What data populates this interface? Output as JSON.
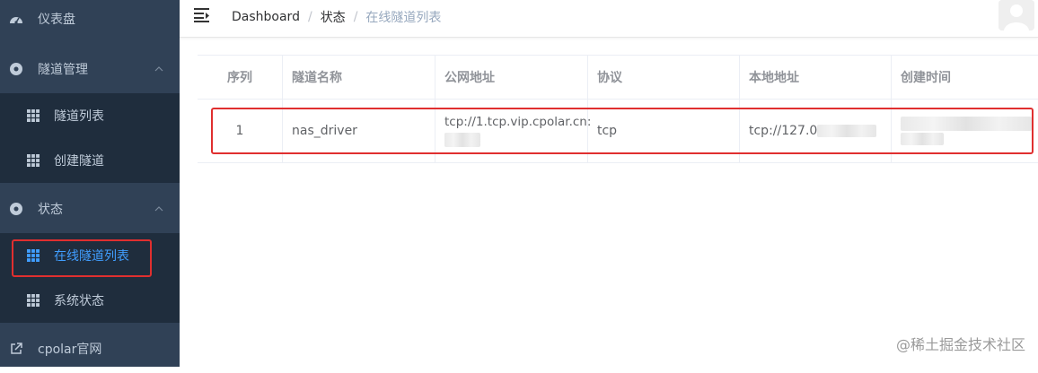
{
  "sidebar": {
    "dashboard": "仪表盘",
    "tunnel_mgmt": "隧道管理",
    "tunnel_list": "隧道列表",
    "create_tunnel": "创建隧道",
    "status": "状态",
    "online_tunnel_list": "在线隧道列表",
    "system_status": "系统状态",
    "cpolar_site": "cpolar官网"
  },
  "breadcrumb": {
    "home": "Dashboard",
    "mid": "状态",
    "current": "在线隧道列表",
    "sep": "/"
  },
  "table": {
    "headers": [
      "序列",
      "隧道名称",
      "公网地址",
      "协议",
      "本地地址",
      "创建时间"
    ],
    "row": {
      "index": "1",
      "name": "nas_driver",
      "public_addr": "tcp://1.tcp.vip.cpolar.cn:",
      "protocol": "tcp",
      "local_addr": "tcp://127.0"
    }
  },
  "watermark": "@稀土掘金技术社区",
  "colors": {
    "sidebar_bg": "#304156",
    "submenu_bg": "#1f2d3d",
    "active": "#409eff",
    "highlight": "#e02f2f"
  }
}
